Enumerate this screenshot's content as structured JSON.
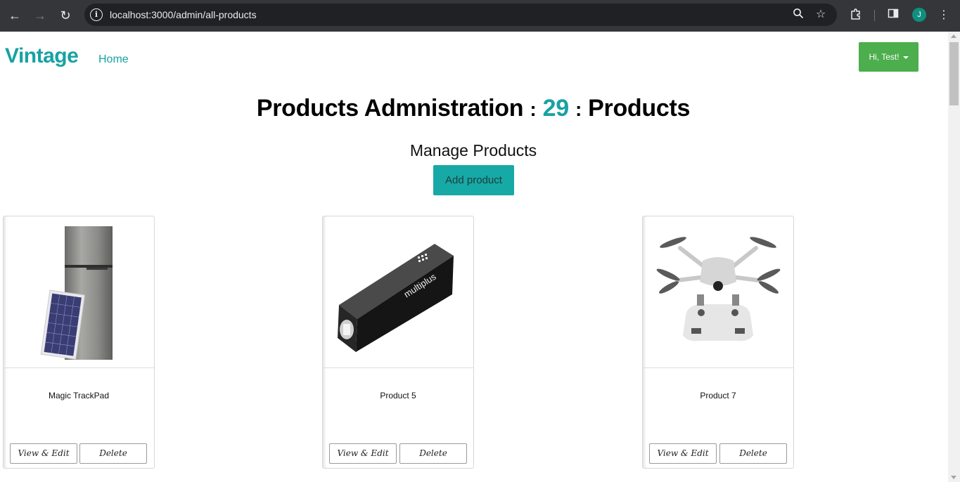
{
  "browser": {
    "url": "localhost:3000/admin/all-products",
    "profile_initial": "J"
  },
  "navbar": {
    "brand": "Vintage",
    "home_link": "Home",
    "user_menu_label": "Hi, Test!"
  },
  "header": {
    "title_prefix": "Products Admnistration",
    "separator": ":",
    "count": "29",
    "title_suffix": "Products",
    "subtitle": "Manage Products",
    "add_button": "Add product"
  },
  "products": [
    {
      "name": "Magic TrackPad",
      "edit_label": "View & Edit",
      "delete_label": "Delete",
      "image": "refrigerator-with-solar-panel"
    },
    {
      "name": "Product 5",
      "edit_label": "View & Edit",
      "delete_label": "Delete",
      "image": "multiplus-power-bank"
    },
    {
      "name": "Product 7",
      "edit_label": "View & Edit",
      "delete_label": "Delete",
      "image": "drone-with-controller"
    }
  ],
  "colors": {
    "accent": "#17a2a3",
    "user_button": "#4cae4c",
    "add_button": "#17a9a6"
  }
}
